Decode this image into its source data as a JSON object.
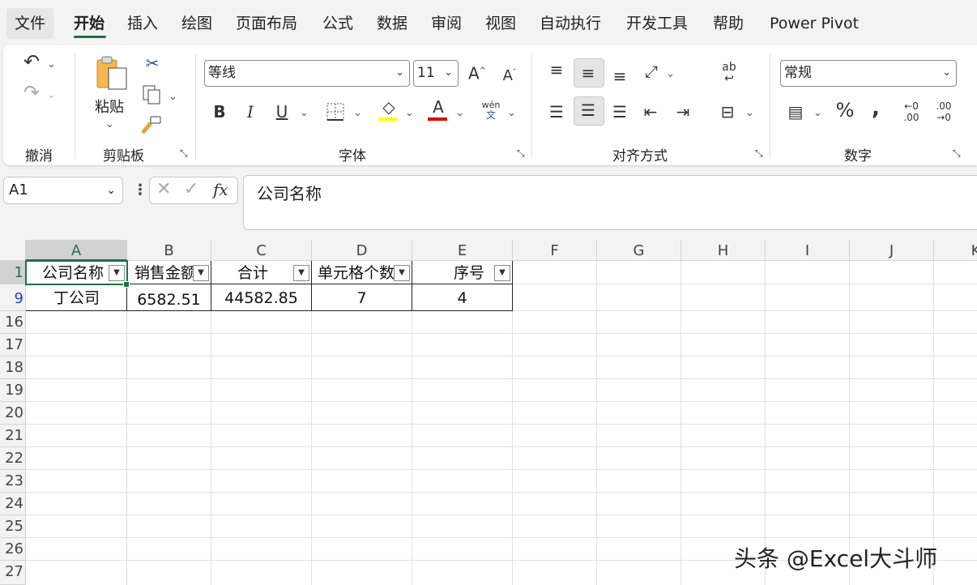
{
  "tabs": [
    "文件",
    "开始",
    "插入",
    "绘图",
    "页面布局",
    "公式",
    "数据",
    "审阅",
    "视图",
    "自动执行",
    "开发工具",
    "帮助",
    "Power Pivot"
  ],
  "ribbon": {
    "undo_group": "撤消",
    "clipboard_group": "剪贴板",
    "paste_label": "粘贴",
    "font_group": "字体",
    "font_name": "等线",
    "font_size": "11",
    "alignment_group": "对齐方式",
    "number_group": "数字",
    "number_format": "常规",
    "bold": "B",
    "italic": "I",
    "underline": "U",
    "phonetic_top": "wén",
    "phonetic_bottom": "文"
  },
  "formula_bar": {
    "name_box": "A1",
    "fx": "fx",
    "content": "公司名称"
  },
  "sheet": {
    "columns": [
      "A",
      "B",
      "C",
      "D",
      "E",
      "F",
      "G",
      "H",
      "I",
      "J",
      "K"
    ],
    "rows": [
      "1",
      "9",
      "16",
      "17",
      "18",
      "19",
      "20",
      "21",
      "22",
      "23",
      "24",
      "25",
      "26",
      "27"
    ],
    "header_row": [
      "公司名称",
      "销售金额",
      "合计",
      "单元格个数",
      "序号"
    ],
    "data_row": [
      "丁公司",
      "6582.51",
      "44582.85",
      "7",
      "4"
    ]
  },
  "watermark": "头条 @Excel大斗师",
  "colors": {
    "accent": "#1e7145",
    "filtered_row": "#1f3fd6",
    "fill_color": "#ffff00",
    "font_color": "#e00000"
  }
}
